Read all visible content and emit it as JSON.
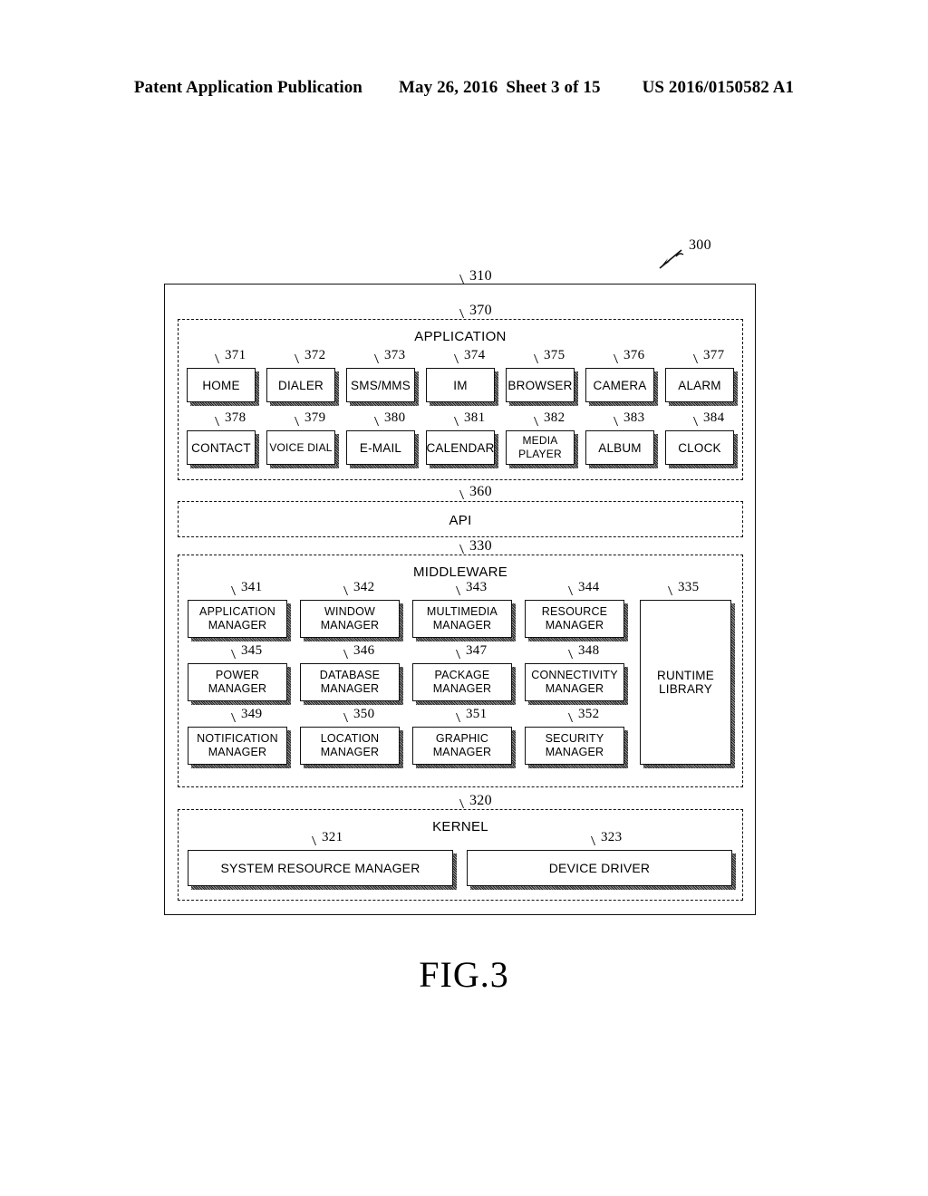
{
  "header": {
    "publication": "Patent Application Publication",
    "date": "May 26, 2016",
    "sheet": "Sheet 3 of 15",
    "number": "US 2016/0150582 A1"
  },
  "figure": {
    "caption": "FIG.3",
    "system_ref": "300",
    "outer_ref": "310"
  },
  "application_layer": {
    "ref": "370",
    "title": "APPLICATION",
    "row1": [
      {
        "ref": "371",
        "label": "HOME"
      },
      {
        "ref": "372",
        "label": "DIALER"
      },
      {
        "ref": "373",
        "label": "SMS/MMS"
      },
      {
        "ref": "374",
        "label": "IM"
      },
      {
        "ref": "375",
        "label": "BROWSER"
      },
      {
        "ref": "376",
        "label": "CAMERA"
      },
      {
        "ref": "377",
        "label": "ALARM"
      }
    ],
    "row2": [
      {
        "ref": "378",
        "label": "CONTACT"
      },
      {
        "ref": "379",
        "label": "VOICE DIAL"
      },
      {
        "ref": "380",
        "label": "E-MAIL"
      },
      {
        "ref": "381",
        "label": "CALENDAR"
      },
      {
        "ref": "382",
        "label": "MEDIA PLAYER"
      },
      {
        "ref": "383",
        "label": "ALBUM"
      },
      {
        "ref": "384",
        "label": "CLOCK"
      }
    ]
  },
  "api_layer": {
    "ref": "360",
    "title": "API"
  },
  "middleware_layer": {
    "ref": "330",
    "title": "MIDDLEWARE",
    "row1": [
      {
        "ref": "341",
        "label": "APPLICATION MANAGER"
      },
      {
        "ref": "342",
        "label": "WINDOW MANAGER"
      },
      {
        "ref": "343",
        "label": "MULTIMEDIA MANAGER"
      },
      {
        "ref": "344",
        "label": "RESOURCE MANAGER"
      }
    ],
    "row2": [
      {
        "ref": "345",
        "label": "POWER MANAGER"
      },
      {
        "ref": "346",
        "label": "DATABASE MANAGER"
      },
      {
        "ref": "347",
        "label": "PACKAGE MANAGER"
      },
      {
        "ref": "348",
        "label": "CONNECTIVITY MANAGER"
      }
    ],
    "row3": [
      {
        "ref": "349",
        "label": "NOTIFICATION MANAGER"
      },
      {
        "ref": "350",
        "label": "LOCATION MANAGER"
      },
      {
        "ref": "351",
        "label": "GRAPHIC MANAGER"
      },
      {
        "ref": "352",
        "label": "SECURITY MANAGER"
      }
    ],
    "runtime": {
      "ref": "335",
      "label": "RUNTIME LIBRARY"
    }
  },
  "kernel_layer": {
    "ref": "320",
    "title": "KERNEL",
    "items": [
      {
        "ref": "321",
        "label": "SYSTEM RESOURCE MANAGER"
      },
      {
        "ref": "323",
        "label": "DEVICE DRIVER"
      }
    ]
  }
}
